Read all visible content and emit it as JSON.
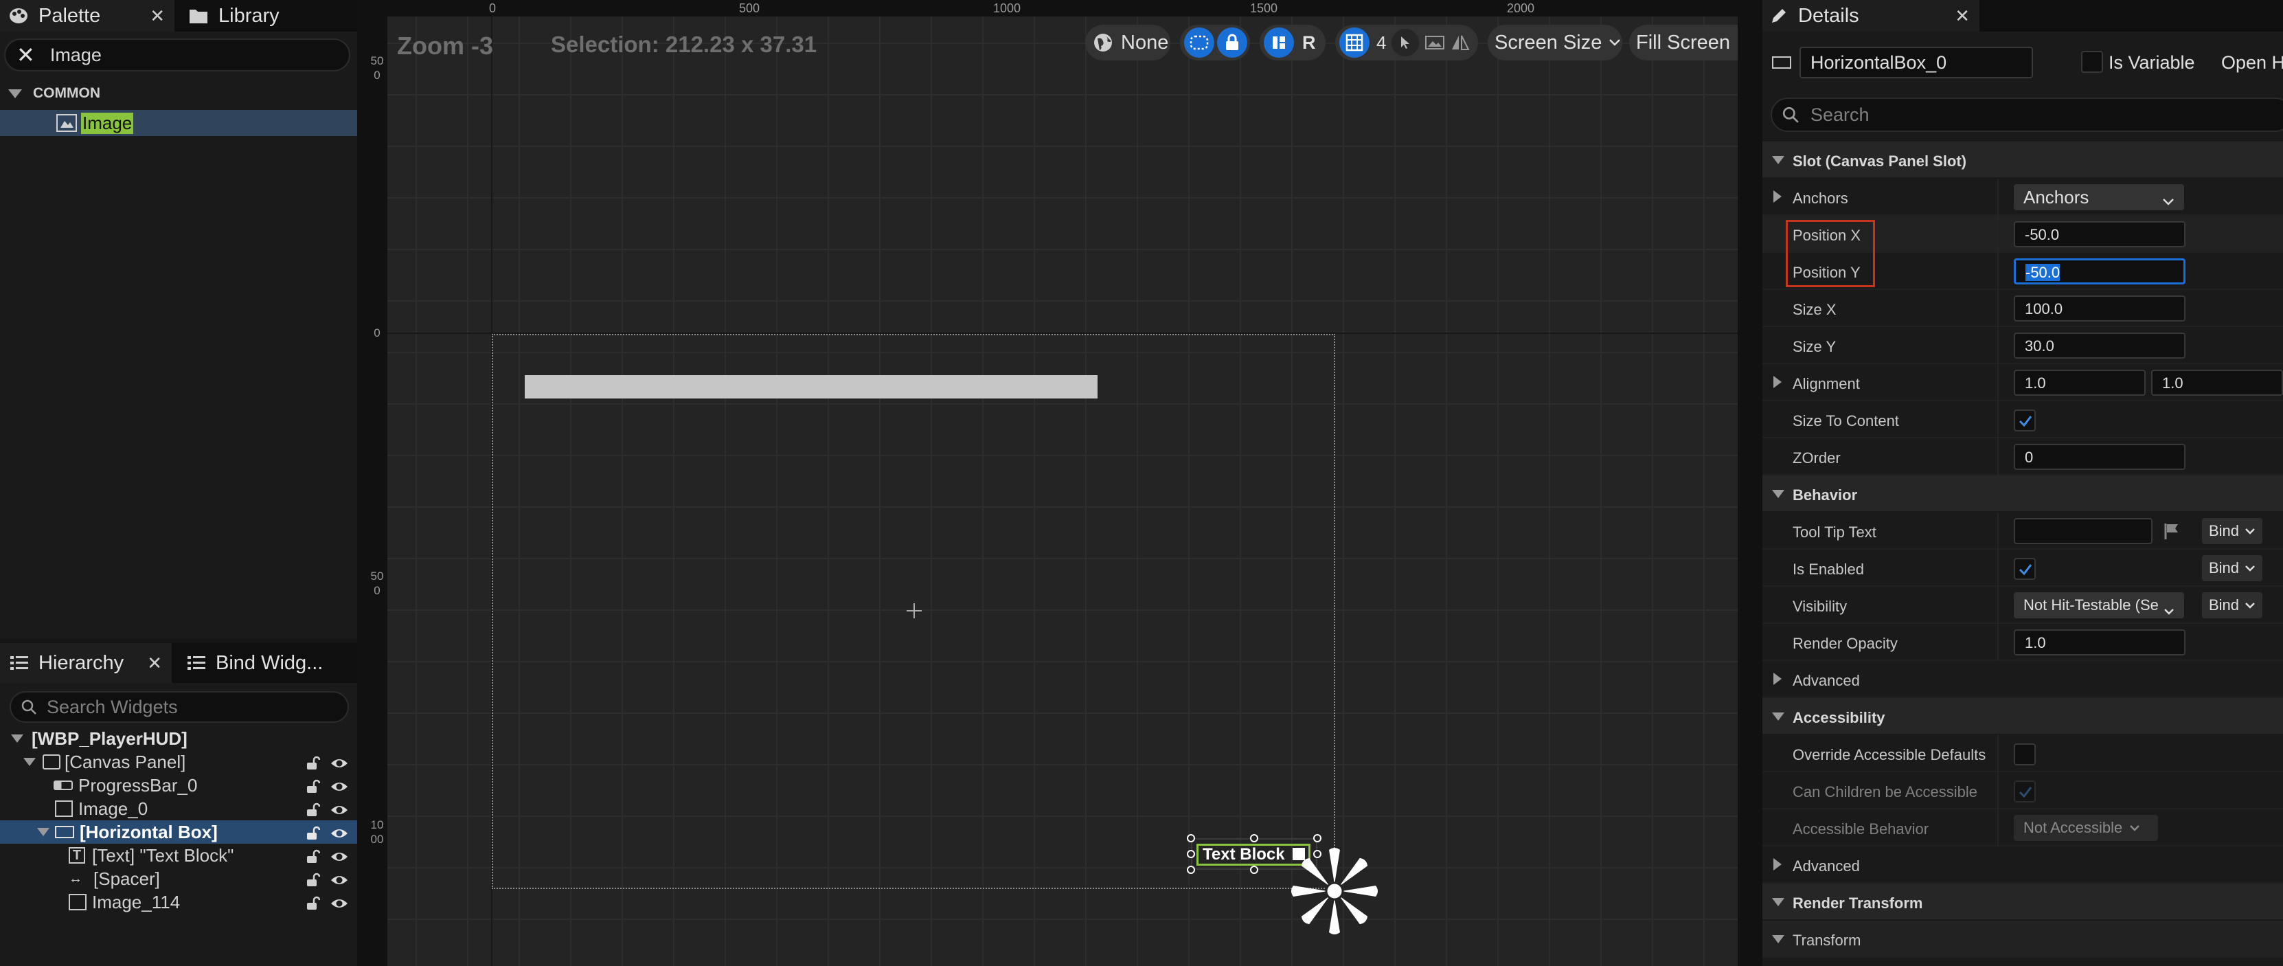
{
  "palette": {
    "tab_label": "Palette",
    "library_label": "Library",
    "search_value": "Image",
    "category": "COMMON",
    "result": "Image"
  },
  "hierarchy": {
    "tab_label": "Hierarchy",
    "bind_tab_label": "Bind Widg...",
    "search_placeholder": "Search Widgets",
    "items": [
      {
        "label": "[WBP_PlayerHUD]"
      },
      {
        "label": "[Canvas Panel]"
      },
      {
        "label": "ProgressBar_0"
      },
      {
        "label": "Image_0"
      },
      {
        "label": "[Horizontal Box]"
      },
      {
        "label": "[Text] \"Text Block\""
      },
      {
        "label": "[Spacer]"
      },
      {
        "label": "Image_114"
      }
    ]
  },
  "viewport": {
    "zoom": "Zoom -3",
    "selection": "Selection: 212.23 x 37.31",
    "ruler_top": [
      "0",
      "500",
      "1000",
      "1500",
      "2000"
    ],
    "ruler_left": [
      "500",
      "0",
      "500",
      "1000"
    ],
    "text_block_label": "Text Block",
    "toolbar": {
      "localize": "None",
      "r_label": "R",
      "grid_snap": "4",
      "screen_size": "Screen Size",
      "fill_screen": "Fill Screen"
    }
  },
  "details": {
    "tab_label": "Details",
    "name_value": "HorizontalBox_0",
    "is_variable": "Is Variable",
    "open_hierarchy": "Open H",
    "search_placeholder": "Search",
    "sections": {
      "slot": "Slot (Canvas Panel Slot)",
      "behavior": "Behavior",
      "accessibility": "Accessibility",
      "render_transform": "Render Transform"
    },
    "rows": {
      "anchors": {
        "label": "Anchors",
        "value": "Anchors"
      },
      "pos_x": {
        "label": "Position X",
        "value": "-50.0"
      },
      "pos_y": {
        "label": "Position Y",
        "value": "-50.0"
      },
      "size_x": {
        "label": "Size X",
        "value": "100.0"
      },
      "size_y": {
        "label": "Size Y",
        "value": "30.0"
      },
      "alignment": {
        "label": "Alignment",
        "value_x": "1.0",
        "value_y": "1.0"
      },
      "size_to_content": {
        "label": "Size To Content"
      },
      "zorder": {
        "label": "ZOrder",
        "value": "0"
      },
      "tooltip": {
        "label": "Tool Tip Text"
      },
      "is_enabled": {
        "label": "Is Enabled"
      },
      "visibility": {
        "label": "Visibility",
        "value": "Not Hit-Testable (Se"
      },
      "render_opacity": {
        "label": "Render Opacity",
        "value": "1.0"
      },
      "advanced": {
        "label": "Advanced"
      },
      "override_accessible": {
        "label": "Override Accessible Defaults"
      },
      "children_accessible": {
        "label": "Can Children be Accessible"
      },
      "accessible_behavior": {
        "label": "Accessible Behavior",
        "value": "Not Accessible"
      },
      "advanced2": {
        "label": "Advanced"
      },
      "transform": {
        "label": "Transform"
      }
    },
    "bind_label": "Bind"
  },
  "colors": {
    "accent_blue": "#1a6fd6",
    "highlight_red": "#c6341c",
    "match_green": "#8ac43c",
    "selected_row": "#294a70"
  }
}
